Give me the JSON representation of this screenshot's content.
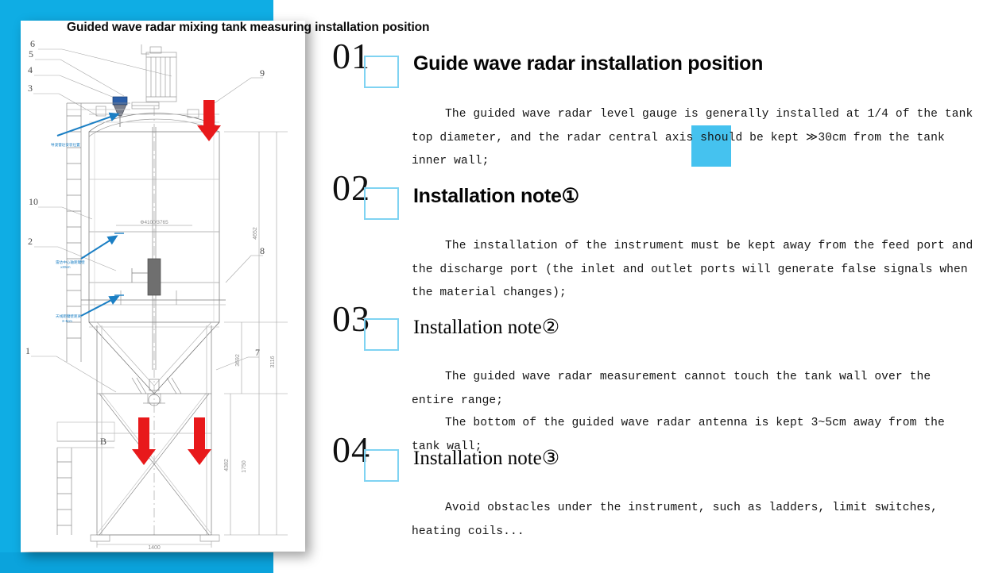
{
  "page_title": "Guided wave radar mixing tank measuring installation position",
  "colors": {
    "accent_blue": "#0FADE4",
    "cyan_square": "#45C2EF",
    "marker_outline": "#7FD3F2",
    "arrow_red": "#E8191B",
    "annotation_blue": "#1B7FC4"
  },
  "sections": [
    {
      "number": "01",
      "heading": "Guide wave radar installation position",
      "heading_style": "sans",
      "paragraphs": [
        "The guided wave radar level gauge is generally installed at 1/4 of the tank top diameter, and the radar central axis should be kept ≫30cm from the tank inner wall;"
      ]
    },
    {
      "number": "02",
      "heading": "Installation note①",
      "heading_style": "sans",
      "paragraphs": [
        "The installation of the instrument must be kept away from the feed port and the discharge port (the inlet and outlet ports will generate false signals when the material changes);"
      ]
    },
    {
      "number": "03",
      "heading": "Installation note②",
      "heading_style": "serif",
      "paragraphs": [
        "The guided wave radar measurement cannot touch the tank wall over the entire range;",
        "The bottom of the guided wave radar antenna is kept 3~5cm away from the tank wall;"
      ]
    },
    {
      "number": "04",
      "heading": "Installation note③",
      "heading_style": "serif",
      "paragraphs": [
        "Avoid obstacles under the instrument, such as ladders, limit switches, heating coils..."
      ]
    }
  ],
  "drawing": {
    "title": "mixing tank elevation drawing",
    "callouts": [
      "6",
      "5",
      "4",
      "3",
      "10",
      "2",
      "1",
      "9",
      "8",
      "7",
      "B"
    ],
    "dimension_labels": [
      "4652",
      "3116",
      "3692",
      "1750",
      "4382",
      "1400"
    ],
    "diameter_label": "φ4100/3765",
    "annotations": [
      "导波雷达安装位置",
      "天线距罐壁距离 3~5cm",
      "雷达中心轴距罐壁 ≥30cm"
    ],
    "arrow_count_red": 3
  }
}
